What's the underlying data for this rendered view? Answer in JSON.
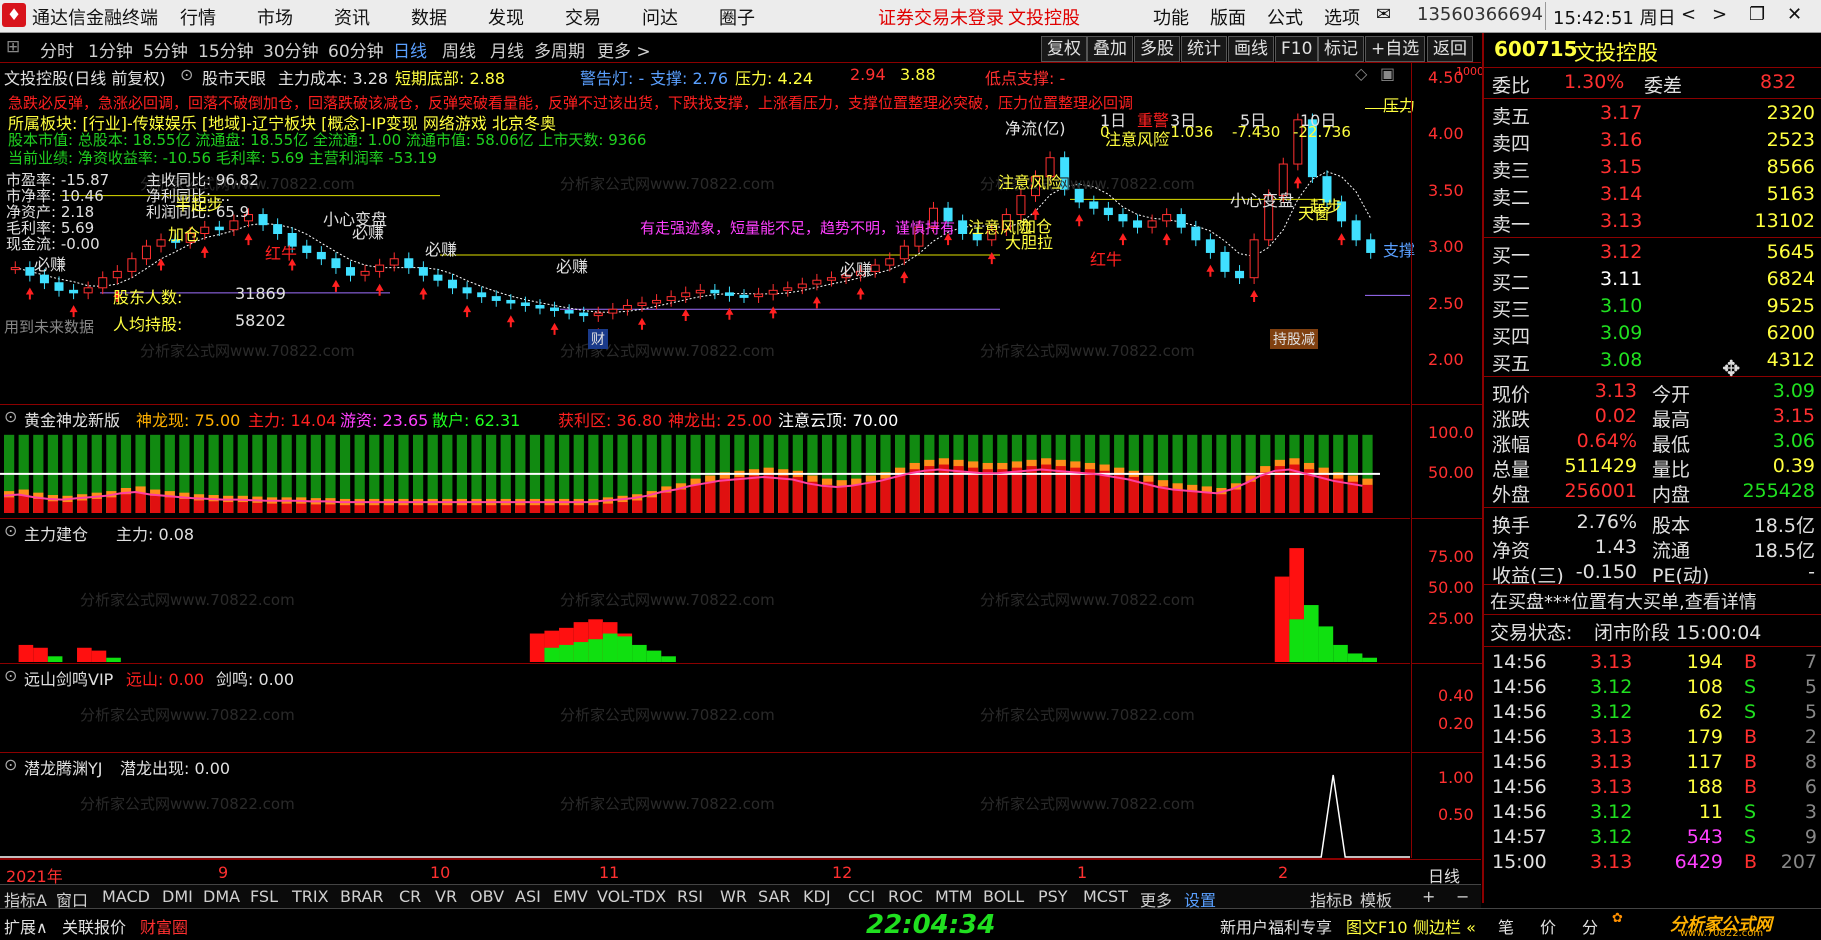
{
  "menubar": {
    "app_title": "通达信金融终端",
    "menus": [
      "行情",
      "市场",
      "资讯",
      "数据",
      "发现",
      "交易",
      "问达",
      "圈子"
    ],
    "login_status": "证券交易未登录",
    "stock_name": "文投控股",
    "right_menus": [
      "功能",
      "版面",
      "公式",
      "选项"
    ],
    "phone": "13560366694",
    "clock": "15:42:51 周日",
    "win_controls": [
      "<",
      ">",
      "❐",
      "✕"
    ]
  },
  "periodbar": {
    "periods": [
      "分时",
      "1分钟",
      "5分钟",
      "15分钟",
      "30分钟",
      "60分钟",
      "日线",
      "周线",
      "月线",
      "多周期",
      "更多 >"
    ],
    "active_index": 6,
    "tools": [
      "复权",
      "叠加",
      "多股",
      "统计",
      "画线",
      "F10",
      "标记",
      "+自选",
      "返回"
    ]
  },
  "main_chart": {
    "header_name": "文投控股(日线 前复权)",
    "header_indicator": "股市天眼",
    "cost_label": "主力成本: 3.28",
    "bottom_label": "短期底部: 2.88",
    "warn_label": "警告灯: -",
    "support_label": "支撑: 2.76",
    "pressure_label": "压力: 4.24",
    "v1": "2.94",
    "v2": "3.88",
    "low_support": "低点支撑: -",
    "line_red": "急跌必反弹，急涨必回调，回落不破倒加仓，回落跌破该减仓，反弹突破看量能，反弹不过该出货，下跌找支撑，上涨看压力，支撑位置整理必突破，压力位置整理必回调",
    "line_yellow": "所属板块: [行业]-传媒娱乐 [地域]-辽宁板块 [概念]-IP变现 网络游戏 北京冬奥",
    "line_green1": "股本市值: 总股本: 18.55亿 流通盘: 18.55亿 全流通: 1.00 流通市值: 58.06亿 上市天数: 9366",
    "line_green2": "当前业绩: 净资收益率: -10.56 毛利率: 5.69 主营利润率 -53.19",
    "fund_lines": [
      "市盈率: -15.87",
      "市净率: 10.46",
      "净资产: 2.18",
      "毛利率: 5.69",
      "现金流: -0.00"
    ],
    "fund_lines2": [
      "主收同比: 96.82",
      "净利同比: ...",
      "利润同比: 65.9"
    ],
    "holders_label": "股东人数:",
    "holders_value": "31869",
    "avg_label": "人均持股:",
    "avg_value": "58202",
    "netflow_label": "净流(亿)",
    "netflow_periods": [
      "1日",
      "3日",
      "5日",
      "10日"
    ],
    "netflow_values": [
      "0",
      "-1.036",
      "-7.430",
      "-22.736"
    ],
    "annotations": [
      "小心变盘",
      "注意风险",
      "注意风险",
      "注意风险",
      "必赚",
      "必赚",
      "必赚",
      "必赚",
      "必赚",
      "红牛",
      "红牛",
      "半起步",
      "加仓",
      "加仓",
      "大胆拉",
      "起步",
      "天窗",
      "压力",
      "支撑",
      "重警"
    ],
    "trend_text": "有走强迹象，短量能不足，趋势不明，谨慎持有",
    "future_text": "用到未来数据",
    "cai_tag": "财",
    "reduce_tag": "持股减",
    "yaxis": [
      "4.50",
      "4.00",
      "3.50",
      "3.00",
      "2.50",
      "2.00"
    ],
    "chart_data": {
      "type": "candlestick",
      "ylim": [
        1.9,
        4.6
      ],
      "yticks": [
        2.0,
        2.5,
        3.0,
        3.5,
        4.0,
        4.5
      ],
      "close": [
        2.98,
        2.92,
        2.86,
        2.8,
        2.78,
        2.82,
        2.9,
        2.95,
        3.05,
        3.15,
        3.2,
        3.18,
        3.25,
        3.3,
        3.28,
        3.35,
        3.4,
        3.32,
        3.25,
        3.15,
        3.1,
        3.05,
        2.98,
        2.92,
        2.95,
        3.0,
        3.05,
        2.98,
        2.92,
        2.88,
        2.82,
        2.78,
        2.75,
        2.72,
        2.7,
        2.68,
        2.66,
        2.64,
        2.62,
        2.6,
        2.62,
        2.65,
        2.68,
        2.7,
        2.72,
        2.75,
        2.78,
        2.8,
        2.78,
        2.76,
        2.75,
        2.77,
        2.8,
        2.82,
        2.85,
        2.88,
        2.9,
        2.92,
        2.95,
        3.0,
        3.05,
        3.15,
        3.3,
        3.45,
        3.35,
        3.25,
        3.2,
        3.28,
        3.4,
        3.55,
        3.7,
        3.85,
        3.6,
        3.5,
        3.45,
        3.4,
        3.35,
        3.3,
        3.35,
        3.4,
        3.3,
        3.2,
        3.1,
        2.95,
        2.9,
        3.2,
        3.55,
        3.8,
        4.15,
        3.7,
        3.5,
        3.35,
        3.2,
        3.1
      ]
    }
  },
  "panel_jinlong": {
    "name": "黄金神龙新版",
    "items": [
      {
        "label": "神龙现:",
        "value": "75.00",
        "color": "#ffb000"
      },
      {
        "label": "主力:",
        "value": "14.04",
        "color": "#ff2020"
      },
      {
        "label": "游资:",
        "value": "23.65",
        "color": "#ff40ff"
      },
      {
        "label": "散户:",
        "value": "62.31",
        "color": "#20ff20"
      },
      {
        "label": "获利区:",
        "value": "36.80",
        "color": "#ff2020"
      },
      {
        "label": "神龙出:",
        "value": "25.00",
        "color": "#ff2020"
      },
      {
        "label": "注意云顶:",
        "value": "70.00",
        "color": "#ffffff"
      }
    ],
    "yaxis": [
      "100.0",
      "50.00"
    ],
    "chart_data": {
      "type": "bar",
      "ylim": [
        0,
        110
      ],
      "stack_max": 100,
      "red_heights": [
        20,
        22,
        18,
        15,
        14,
        16,
        18,
        20,
        24,
        26,
        22,
        20,
        18,
        16,
        15,
        14,
        14,
        13,
        12,
        12,
        12,
        11,
        11,
        10,
        10,
        10,
        10,
        10,
        10,
        10,
        10,
        10,
        10,
        10,
        10,
        10,
        10,
        10,
        10,
        10,
        10,
        12,
        14,
        16,
        20,
        26,
        30,
        36,
        40,
        44,
        46,
        48,
        50,
        48,
        46,
        40,
        36,
        34,
        36,
        40,
        44,
        50,
        56,
        60,
        62,
        60,
        58,
        56,
        56,
        58,
        60,
        62,
        60,
        58,
        56,
        54,
        50,
        46,
        40,
        34,
        30,
        28,
        26,
        24,
        30,
        40,
        52,
        60,
        62,
        56,
        50,
        44,
        40,
        36
      ]
    }
  },
  "panel_jiancang": {
    "name": "主力建仓",
    "value_label": "主力: 0.08",
    "yaxis": [
      "75.00",
      "50.00",
      "25.00"
    ],
    "chart_data": {
      "type": "bar",
      "ylim": [
        0,
        85
      ],
      "red": [
        {
          "i": 1,
          "v": 12
        },
        {
          "i": 2,
          "v": 10
        },
        {
          "i": 5,
          "v": 10
        },
        {
          "i": 6,
          "v": 8
        },
        {
          "i": 36,
          "v": 20
        },
        {
          "i": 37,
          "v": 22
        },
        {
          "i": 38,
          "v": 24
        },
        {
          "i": 39,
          "v": 28
        },
        {
          "i": 40,
          "v": 30
        },
        {
          "i": 41,
          "v": 28
        },
        {
          "i": 42,
          "v": 20
        },
        {
          "i": 87,
          "v": 60
        },
        {
          "i": 88,
          "v": 80
        }
      ],
      "green": [
        {
          "i": 3,
          "v": 4
        },
        {
          "i": 7,
          "v": 3
        },
        {
          "i": 37,
          "v": 10
        },
        {
          "i": 38,
          "v": 12
        },
        {
          "i": 39,
          "v": 14
        },
        {
          "i": 40,
          "v": 16
        },
        {
          "i": 41,
          "v": 20
        },
        {
          "i": 42,
          "v": 18
        },
        {
          "i": 43,
          "v": 12
        },
        {
          "i": 44,
          "v": 8
        },
        {
          "i": 45,
          "v": 4
        },
        {
          "i": 88,
          "v": 30
        },
        {
          "i": 89,
          "v": 40
        },
        {
          "i": 90,
          "v": 25
        },
        {
          "i": 91,
          "v": 12
        },
        {
          "i": 92,
          "v": 6
        },
        {
          "i": 93,
          "v": 3
        }
      ]
    }
  },
  "panel_yuanshan": {
    "name": "远山剑鸣VIP",
    "v1_label": "远山: 0.00",
    "v2_label": "剑鸣: 0.00",
    "yaxis": [
      "0.40",
      "0.20"
    ]
  },
  "panel_qianlong": {
    "name": "潜龙腾渊YJ",
    "value_label": "潜龙出现: 0.00",
    "yaxis": [
      "1.00",
      "0.50"
    ],
    "chart_data": {
      "type": "line",
      "spike_index": 91,
      "spike_value": 1.0
    }
  },
  "date_axis": {
    "labels": [
      "2021年",
      "9",
      "10",
      "11",
      "12",
      "1",
      "2"
    ],
    "period": "日线"
  },
  "indicator_bar": {
    "tabs": [
      "指标A",
      "窗口",
      "MACD",
      "DMI",
      "DMA",
      "FSL",
      "TRIX",
      "BRAR",
      "CR",
      "VR",
      "OBV",
      "ASI",
      "EMV",
      "VOL-TDX",
      "RSI",
      "WR",
      "SAR",
      "KDJ",
      "CCI",
      "ROC",
      "MTM",
      "BOLL",
      "PSY",
      "MCST",
      "更多",
      "设置"
    ],
    "right": [
      "指标B",
      "模板",
      "+",
      "−"
    ]
  },
  "statusbar": {
    "left": [
      "扩展∧",
      "关联报价",
      "财富圈"
    ],
    "clock": "22:04:34",
    "right": [
      "新用户福利专享",
      "图文F10",
      "侧边栏 «",
      "笔",
      "价",
      "分"
    ]
  },
  "quote": {
    "code": "600715",
    "name": "文投控股",
    "weibi_label": "委比",
    "weibi": "1.30%",
    "weicha_label": "委差",
    "weicha": "832",
    "sells": [
      {
        "label": "卖五",
        "price": "3.17",
        "vol": "2320"
      },
      {
        "label": "卖四",
        "price": "3.16",
        "vol": "2523"
      },
      {
        "label": "卖三",
        "price": "3.15",
        "vol": "8566"
      },
      {
        "label": "卖二",
        "price": "3.14",
        "vol": "5163"
      },
      {
        "label": "卖一",
        "price": "3.13",
        "vol": "13102"
      }
    ],
    "buys": [
      {
        "label": "买一",
        "price": "3.12",
        "vol": "5645"
      },
      {
        "label": "买二",
        "price": "3.11",
        "vol": "6824"
      },
      {
        "label": "买三",
        "price": "3.10",
        "vol": "9525"
      },
      {
        "label": "买四",
        "price": "3.09",
        "vol": "6200"
      },
      {
        "label": "买五",
        "price": "3.08",
        "vol": "4312"
      }
    ],
    "stats": [
      {
        "l1": "现价",
        "v1": "3.13",
        "l2": "今开",
        "v2": "3.09"
      },
      {
        "l1": "涨跌",
        "v1": "0.02",
        "l2": "最高",
        "v2": "3.15"
      },
      {
        "l1": "涨幅",
        "v1": "0.64%",
        "l2": "最低",
        "v2": "3.06"
      },
      {
        "l1": "总量",
        "v1": "511429",
        "l2": "量比",
        "v2": "0.39"
      },
      {
        "l1": "外盘",
        "v1": "256001",
        "l2": "内盘",
        "v2": "255428"
      }
    ],
    "stats2": [
      {
        "l1": "换手",
        "v1": "2.76%",
        "l2": "股本",
        "v2": "18.5亿"
      },
      {
        "l1": "净资",
        "v1": "1.43",
        "l2": "流通",
        "v2": "18.5亿"
      },
      {
        "l1": "收益(三)",
        "v1": "-0.150",
        "l2": "PE(动)",
        "v2": "-"
      }
    ],
    "notice": "在买盘***位置有大买单,查看详情",
    "trade_state_label": "交易状态:",
    "trade_state": "闭市阶段 15:00:04",
    "ticks": [
      {
        "t": "14:56",
        "p": "3.13",
        "v": "194",
        "d": "B",
        "n": "7"
      },
      {
        "t": "14:56",
        "p": "3.12",
        "v": "108",
        "d": "S",
        "n": "5"
      },
      {
        "t": "14:56",
        "p": "3.12",
        "v": "62",
        "d": "S",
        "n": "5"
      },
      {
        "t": "14:56",
        "p": "3.13",
        "v": "179",
        "d": "B",
        "n": "2"
      },
      {
        "t": "14:56",
        "p": "3.13",
        "v": "117",
        "d": "B",
        "n": "8"
      },
      {
        "t": "14:56",
        "p": "3.13",
        "v": "188",
        "d": "B",
        "n": "6"
      },
      {
        "t": "14:56",
        "p": "3.12",
        "v": "11",
        "d": "S",
        "n": "3"
      },
      {
        "t": "14:57",
        "p": "3.12",
        "v": "543",
        "d": "S",
        "n": "9"
      },
      {
        "t": "15:00",
        "p": "3.13",
        "v": "6429",
        "d": "B",
        "n": "207"
      }
    ],
    "brand": "分析家公式网",
    "brand_url": "www.70822.com"
  },
  "watermark": "分析家公式网www.70822.com"
}
